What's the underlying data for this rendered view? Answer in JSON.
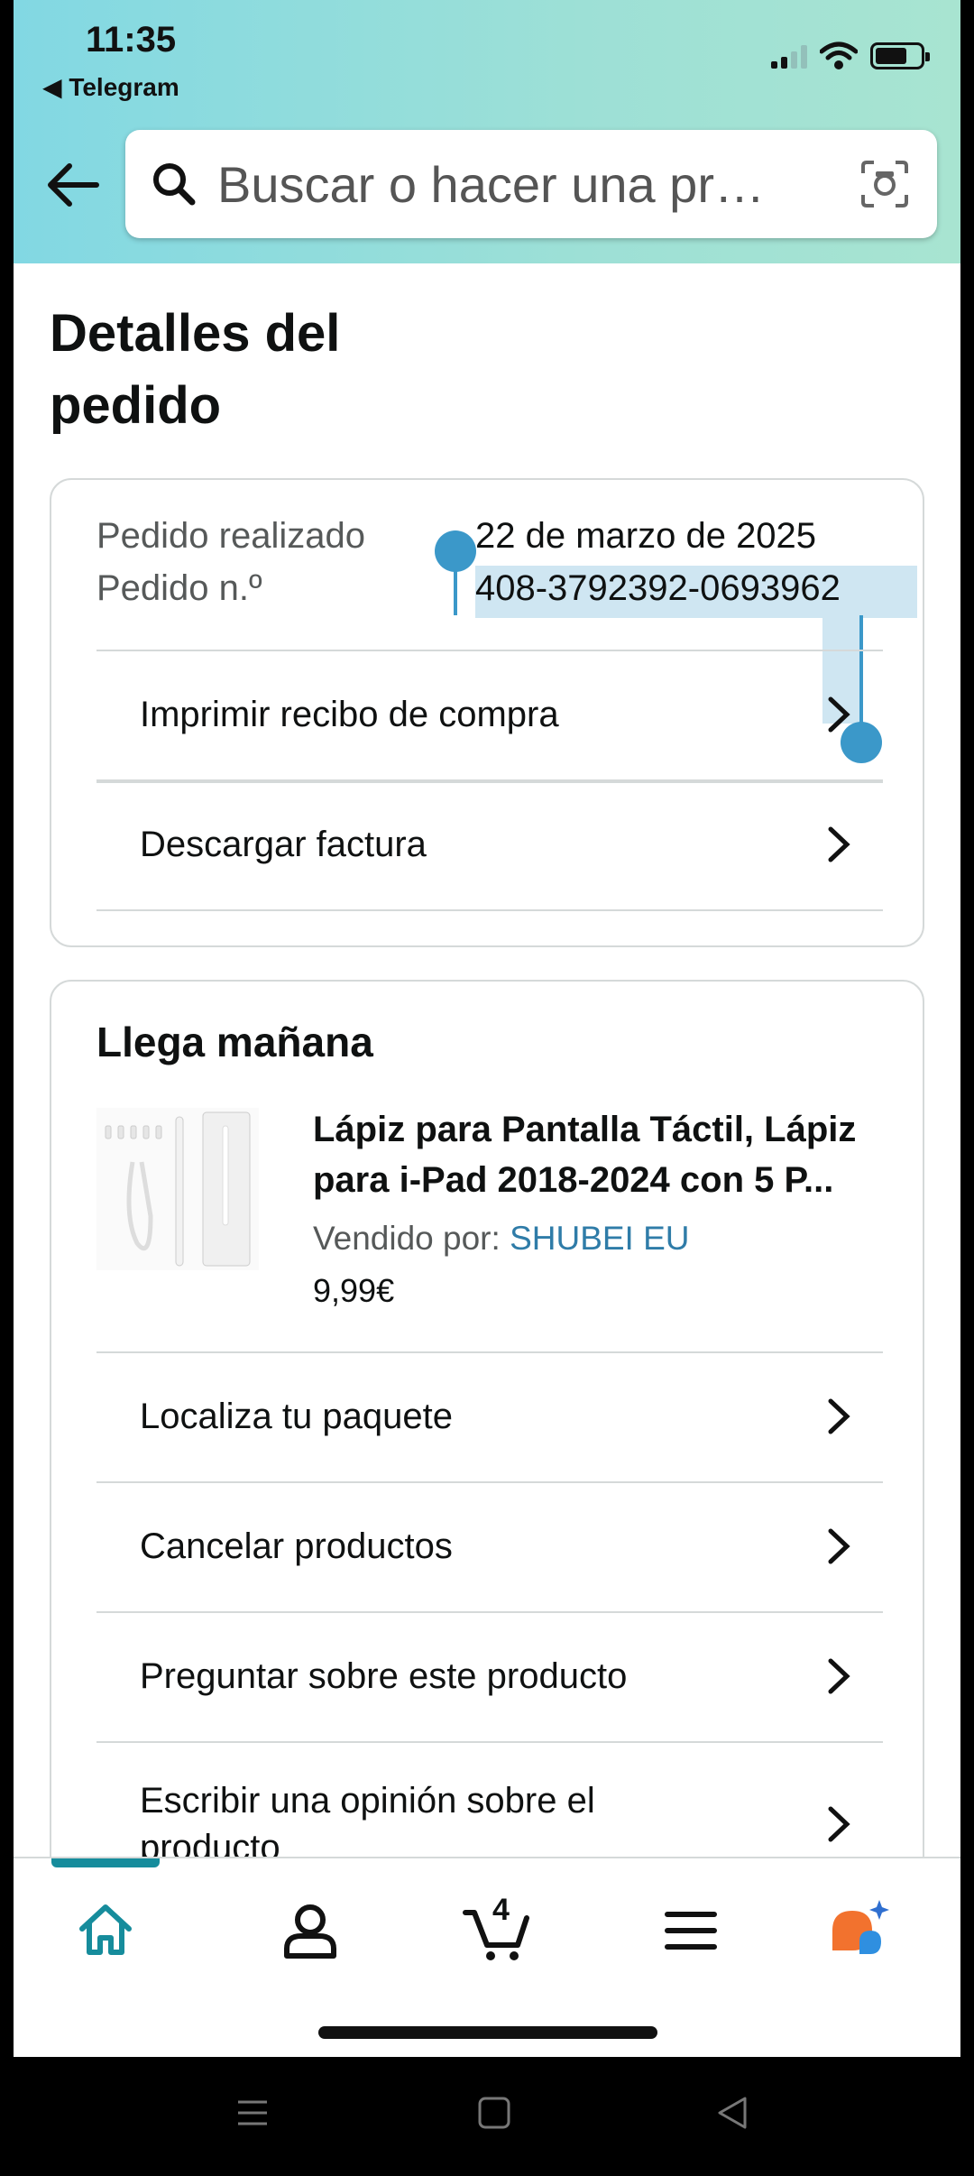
{
  "status": {
    "time": "11:35",
    "back_app": "◀ Telegram"
  },
  "search": {
    "placeholder": "Buscar o hacer una pr…"
  },
  "page": {
    "title": "Detalles del pedido"
  },
  "order": {
    "placed_label": "Pedido realizado",
    "placed_value": "22 de marzo de 2025",
    "number_label": "Pedido n.º",
    "number_value": "408-3792392-0693962",
    "actions": [
      "Imprimir recibo de compra",
      "Descargar factura"
    ]
  },
  "shipment": {
    "title": "Llega mañana",
    "product_title": "Lápiz para Pantalla Táctil, Lápiz para i-Pad 2018-2024 con 5 P...",
    "seller_label": "Vendido por:",
    "seller_name": "SHUBEI EU",
    "price": "9,99€",
    "actions": [
      "Localiza tu paquete",
      "Cancelar productos",
      "Preguntar sobre este producto",
      "Escribir una opinión sobre el producto"
    ]
  },
  "nav": {
    "cart_count": "4",
    "items": [
      "home-icon",
      "account-icon",
      "cart-icon",
      "menu-icon",
      "rufus-icon"
    ]
  },
  "colors": {
    "accent": "#168c9c",
    "link": "#2f7ca8",
    "selection": "#3b98c9",
    "header_start": "#82d8e3",
    "header_end": "#a8e4d1"
  }
}
